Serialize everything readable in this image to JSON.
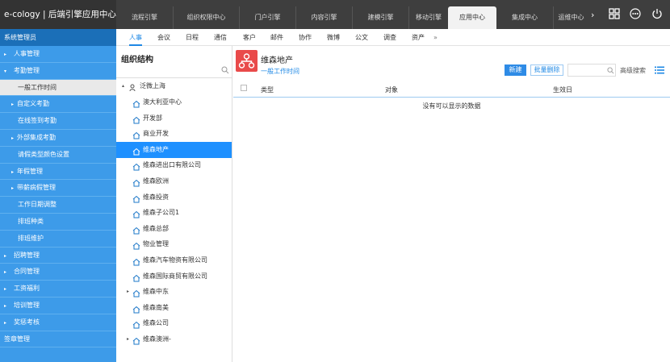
{
  "app": {
    "title": "e-cology | 后端引擎应用中心"
  },
  "top_tabs": [
    "流程引擎",
    "组织权限中心",
    "门户引擎",
    "内容引擎",
    "建模引擎",
    "移动引擎",
    "应用中心",
    "集成中心",
    "运维中心"
  ],
  "top_tab_more": "›",
  "sidebar": {
    "header": "系统管理员",
    "items": [
      {
        "label": "人事管理",
        "arrow": "▸"
      },
      {
        "label": "考勤管理",
        "arrow": "▾"
      },
      {
        "label": "一般工作时间",
        "arrow": ""
      },
      {
        "label": "自定义考勤",
        "arrow": "▸"
      },
      {
        "label": "在线签到考勤",
        "arrow": ""
      },
      {
        "label": "外部集成考勤",
        "arrow": "▸"
      },
      {
        "label": "请假类型颜色设置",
        "arrow": ""
      },
      {
        "label": "年假管理",
        "arrow": "▸"
      },
      {
        "label": "带薪病假管理",
        "arrow": "▸"
      },
      {
        "label": "工作日期调整",
        "arrow": ""
      },
      {
        "label": "排班种类",
        "arrow": ""
      },
      {
        "label": "排班维护",
        "arrow": ""
      },
      {
        "label": "招聘管理",
        "arrow": "▸"
      },
      {
        "label": "合同管理",
        "arrow": "▸"
      },
      {
        "label": "工资福利",
        "arrow": "▸"
      },
      {
        "label": "培训管理",
        "arrow": "▸"
      },
      {
        "label": "奖惩考核",
        "arrow": "▸"
      },
      {
        "label": "签章管理",
        "arrow": ""
      }
    ]
  },
  "sub_tabs": [
    "人事",
    "会议",
    "日程",
    "通信",
    "客户",
    "邮件",
    "协作",
    "微博",
    "公文",
    "调查",
    "资产"
  ],
  "sub_tab_more": "»",
  "tree": {
    "title": "组织结构",
    "root": "泛微上海",
    "nodes": [
      "澳大利亚中心",
      "开发部",
      "商业开发",
      "维森地产",
      "维森进出口有限公司",
      "维森欧洲",
      "维森投资",
      "维森子公司1",
      "维森总部",
      "物业管理",
      "维森汽车物资有限公司",
      "维森国际商贸有限公司",
      "维森中东",
      "维森南美",
      "维森公司",
      "维森澳洲-"
    ]
  },
  "main": {
    "module_title": "维森地产",
    "module_sub": "一般工作时间",
    "new_button": "新建",
    "batch_delete_button": "批量删除",
    "search_placeholder": "",
    "advanced_search": "高级搜索",
    "columns": [
      "类型",
      "对象",
      "生效日"
    ],
    "empty_text": "没有可以显示的数据"
  },
  "colors": {
    "accent": "#1e88e5",
    "sidebar": "#3d9be9",
    "topbar": "#3e3e3e",
    "module_icon": "#e94a4a"
  }
}
